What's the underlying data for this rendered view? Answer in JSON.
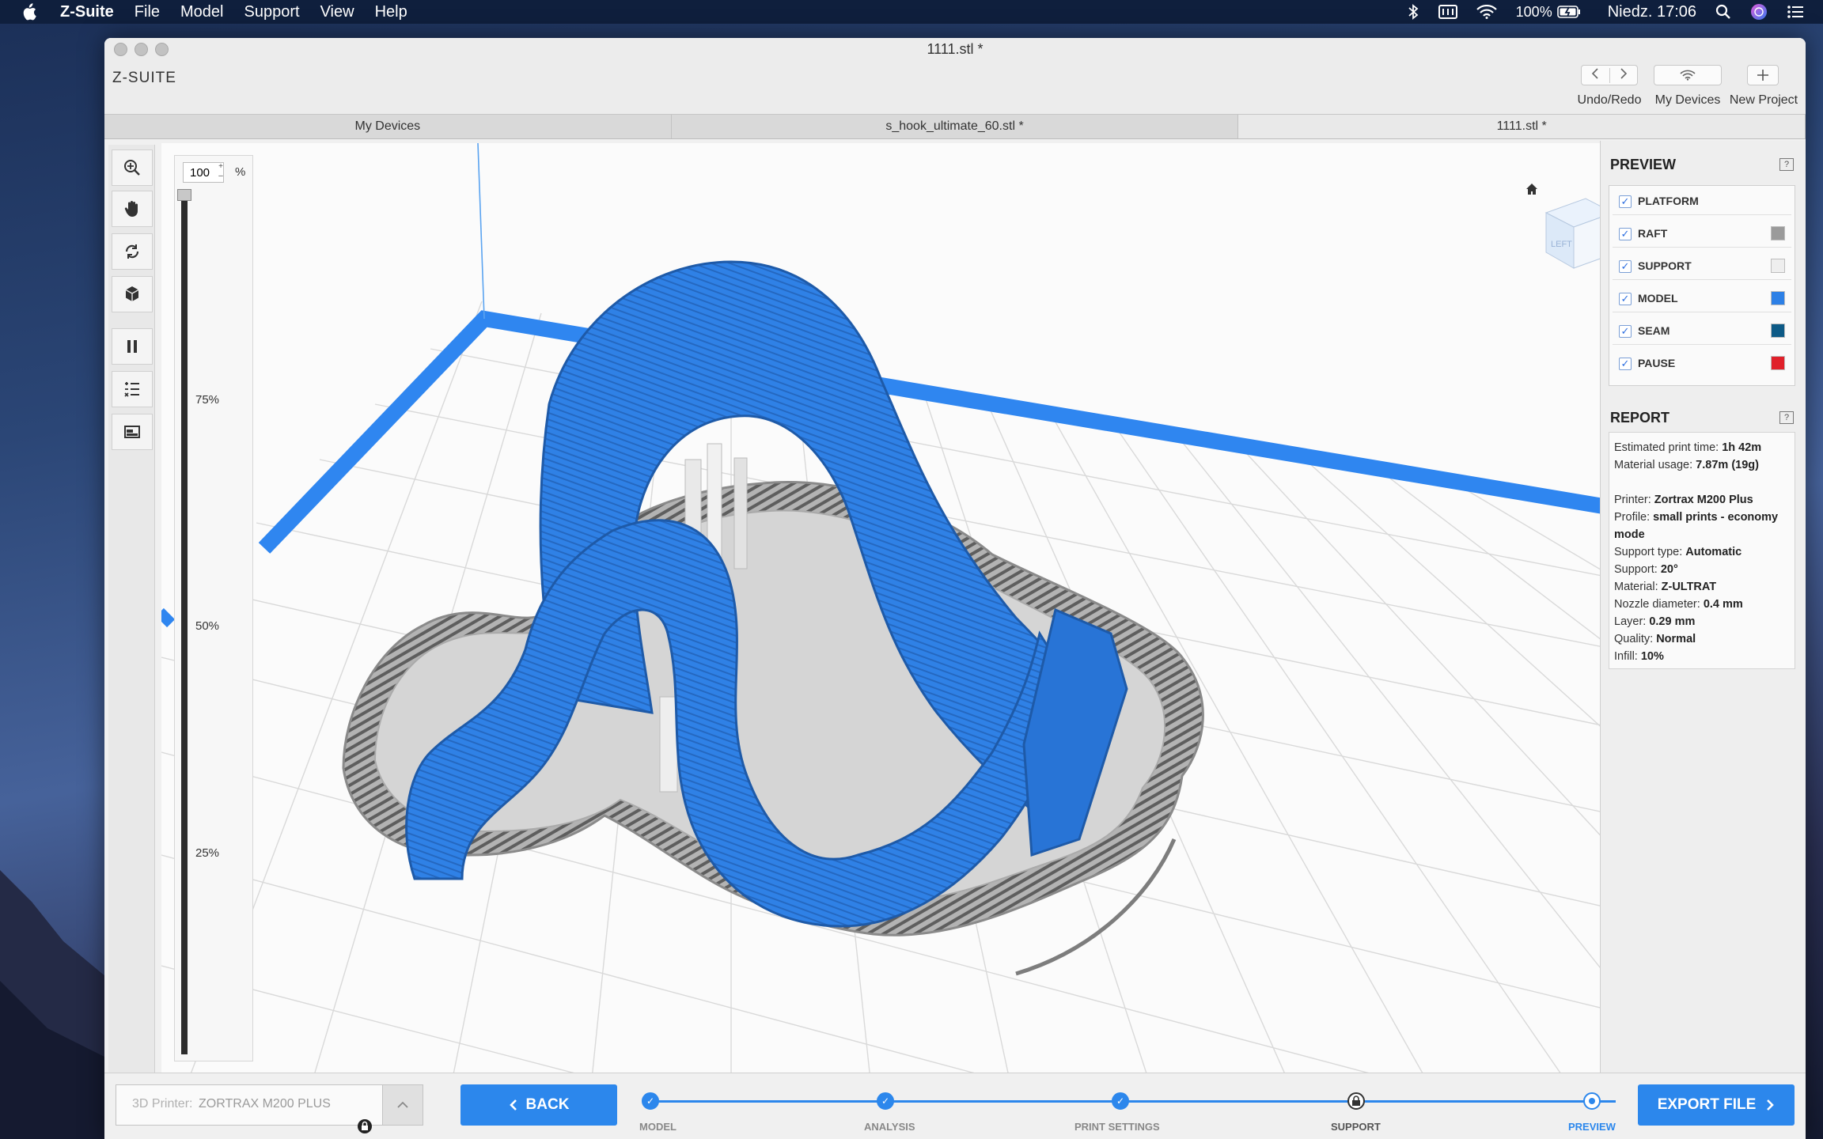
{
  "menubar": {
    "app": "Z-Suite",
    "items": [
      "File",
      "Model",
      "Support",
      "View",
      "Help"
    ],
    "battery": "100%",
    "clock": "Niedz. 17:06"
  },
  "window": {
    "title": "1111.stl *",
    "logo": "Z-SUITE",
    "toolbar": {
      "undo_redo": "Undo/Redo",
      "my_devices": "My Devices",
      "new_project": "New Project"
    },
    "tabs": [
      "My Devices",
      "s_hook_ultimate_60.stl *",
      "1111.stl *"
    ]
  },
  "layer_panel": {
    "zoom_value": "100",
    "zoom_unit": "%",
    "marks": [
      "75%",
      "50%",
      "25%"
    ]
  },
  "view_cube": {
    "face": "LEFT"
  },
  "preview": {
    "title": "PREVIEW",
    "items": [
      {
        "label": "PLATFORM",
        "color": ""
      },
      {
        "label": "RAFT",
        "color": "#9a9a9a"
      },
      {
        "label": "SUPPORT",
        "color": "#eeeeee"
      },
      {
        "label": "MODEL",
        "color": "#2d80e6"
      },
      {
        "label": "SEAM",
        "color": "#0d5a86"
      },
      {
        "label": "PAUSE",
        "color": "#e0202a"
      }
    ]
  },
  "report": {
    "title": "REPORT",
    "print_time_label": "Estimated print time:",
    "print_time": "1h 42m",
    "material_usage_label": "Material usage:",
    "material_usage": "7.87m (19g)",
    "printer_label": "Printer:",
    "printer": "Zortrax M200 Plus",
    "profile_label": "Profile:",
    "profile": "small prints - economy mode",
    "support_type_label": "Support type:",
    "support_type": "Automatic",
    "support_label": "Support:",
    "support": "20°",
    "material_label": "Material:",
    "material": "Z-ULTRAT",
    "nozzle_label": "Nozzle diameter:",
    "nozzle": "0.4 mm",
    "layer_label": "Layer:",
    "layer": "0.29 mm",
    "quality_label": "Quality:",
    "quality": "Normal",
    "infill_label": "Infill:",
    "infill": "10%"
  },
  "bottom": {
    "printer_prefix": "3D Printer:",
    "printer_name": "ZORTRAX M200 PLUS",
    "back": "BACK",
    "export": "EXPORT FILE",
    "steps": [
      "MODEL",
      "ANALYSIS",
      "PRINT SETTINGS",
      "SUPPORT",
      "PREVIEW"
    ]
  },
  "colors": {
    "accent": "#2c87ec",
    "model": "#2d7fe3",
    "raft": "#8f8f8f",
    "platform_edge": "#2f86f0"
  }
}
